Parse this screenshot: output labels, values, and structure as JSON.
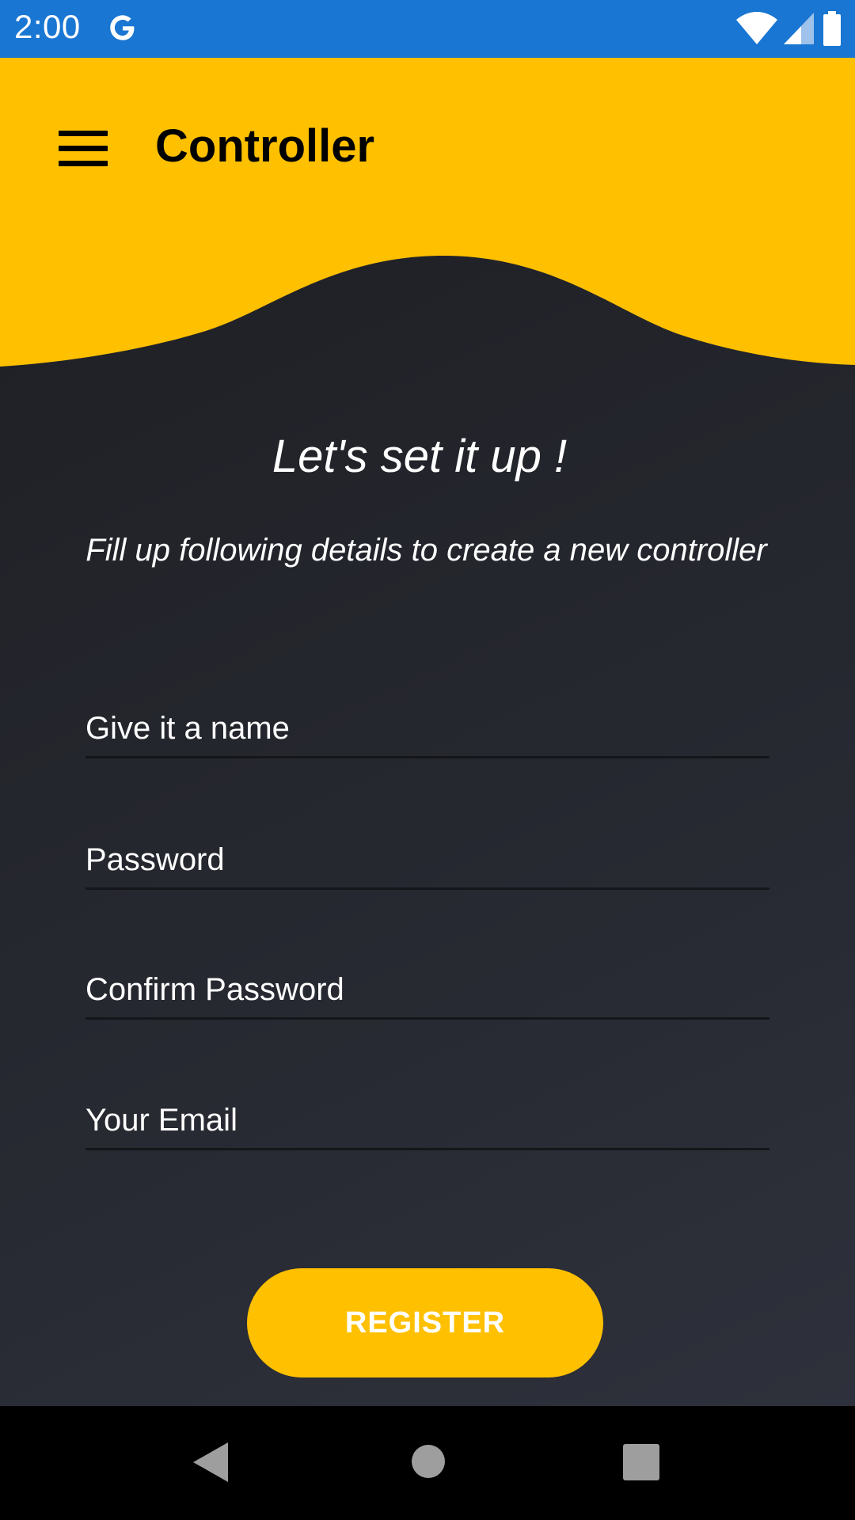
{
  "status_bar": {
    "time": "2:00",
    "notification_icon": "google-g-icon",
    "icons": [
      "wifi-icon",
      "signal-icon",
      "battery-icon"
    ],
    "background_color": "#1976D2"
  },
  "app_bar": {
    "title": "Controller",
    "menu_icon": "hamburger-menu-icon",
    "accent_color": "#FFC000"
  },
  "intro": {
    "headline": "Let's set it up !",
    "subtitle": "Fill up following details to create a new controller"
  },
  "form": {
    "fields": [
      {
        "placeholder": "Give it a name",
        "value": ""
      },
      {
        "placeholder": "Password",
        "value": ""
      },
      {
        "placeholder": "Confirm Password",
        "value": ""
      },
      {
        "placeholder": "Your Email",
        "value": ""
      }
    ],
    "submit_label": "REGISTER"
  },
  "navigation_bar": {
    "buttons": [
      "back-icon",
      "home-icon",
      "recents-icon"
    ]
  }
}
